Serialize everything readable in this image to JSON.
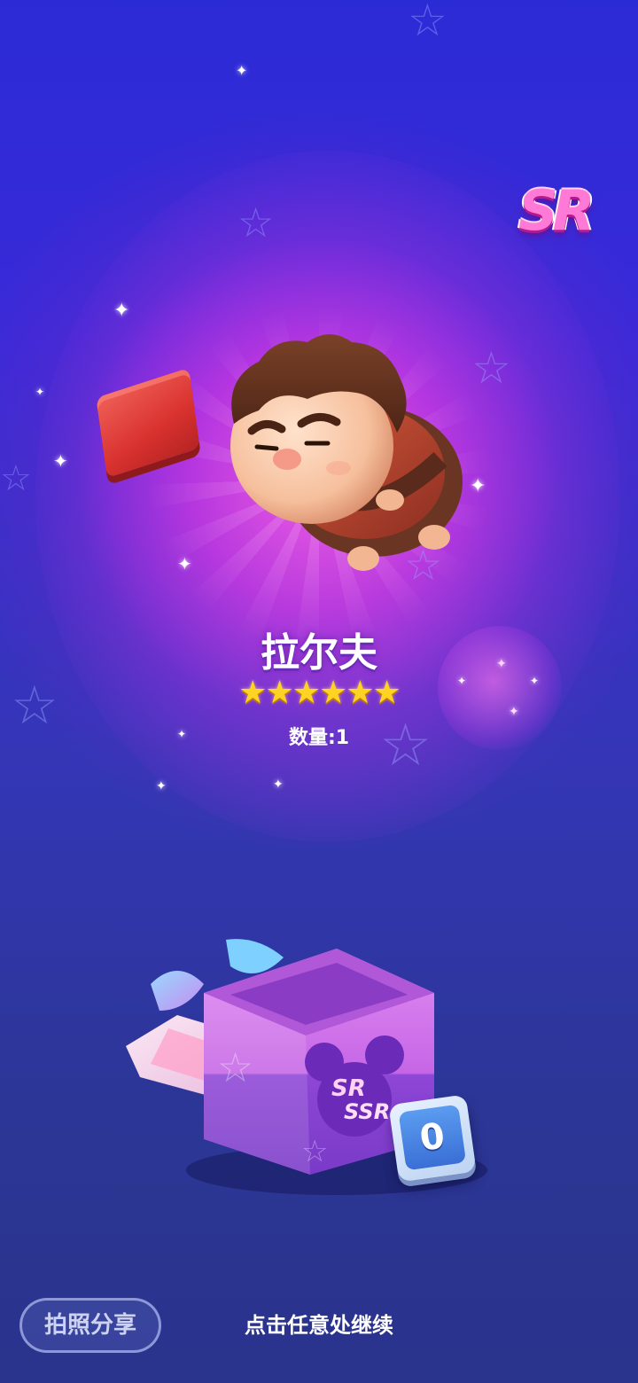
{
  "rarity_badge": "SR",
  "reward": {
    "name": "拉尔夫",
    "star_count": 6,
    "stars": "★★★★★★",
    "quantity_label": "数量:1"
  },
  "gift_box": {
    "counter_value": "0",
    "labels": [
      "SR",
      "SSR"
    ]
  },
  "footer": {
    "share_button_label": "拍照分享",
    "continue_hint": "点击任意处继续"
  },
  "colors": {
    "background_top": "#2b2bd6",
    "background_bottom": "#2a348c",
    "glow": "#ff50dc",
    "star_gold": "#ffd324",
    "badge_pink": "#ff7ad6",
    "counter_blue": "#3a6fd6"
  },
  "icons": {
    "rating": "star-icon",
    "decor": "star-outline-icon",
    "sparkle": "sparkle-icon"
  }
}
